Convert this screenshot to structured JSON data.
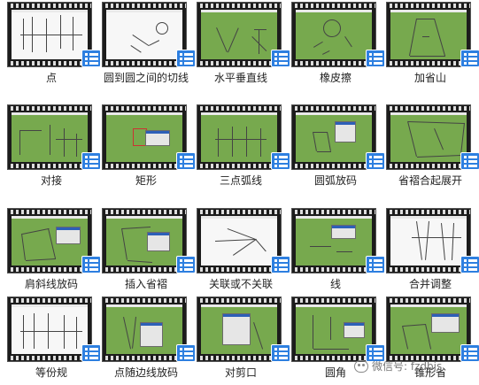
{
  "tiles": [
    {
      "label": "点",
      "screen": "white"
    },
    {
      "label": "圆到圆之间的切线",
      "screen": "white"
    },
    {
      "label": "水平垂直线",
      "screen": "green"
    },
    {
      "label": "橡皮擦",
      "screen": "green"
    },
    {
      "label": "加省山",
      "screen": "green"
    },
    {
      "label": "对接",
      "screen": "green"
    },
    {
      "label": "矩形",
      "screen": "green"
    },
    {
      "label": "三点弧线",
      "screen": "green"
    },
    {
      "label": "圆弧放码",
      "screen": "green"
    },
    {
      "label": "省褶合起展开",
      "screen": "green"
    },
    {
      "label": "肩斜线放码",
      "screen": "green"
    },
    {
      "label": "插入省褶",
      "screen": "green"
    },
    {
      "label": "关联或不关联",
      "screen": "white"
    },
    {
      "label": "线",
      "screen": "green"
    },
    {
      "label": "合并调整",
      "screen": "white"
    },
    {
      "label": "等份规",
      "screen": "white"
    },
    {
      "label": "点随边线放码",
      "screen": "green"
    },
    {
      "label": "对剪口",
      "screen": "green"
    },
    {
      "label": "圆角",
      "screen": "green"
    },
    {
      "label": "锥形省",
      "screen": "green"
    }
  ],
  "watermark": {
    "text": "微信号: fzdbjs",
    "icon": "wechat-icon"
  },
  "badge_icon": "video-list-icon",
  "colors": {
    "film": "#1c1c1c",
    "screen_green": "#77a94e",
    "badge_blue": "#2d7fe0"
  }
}
